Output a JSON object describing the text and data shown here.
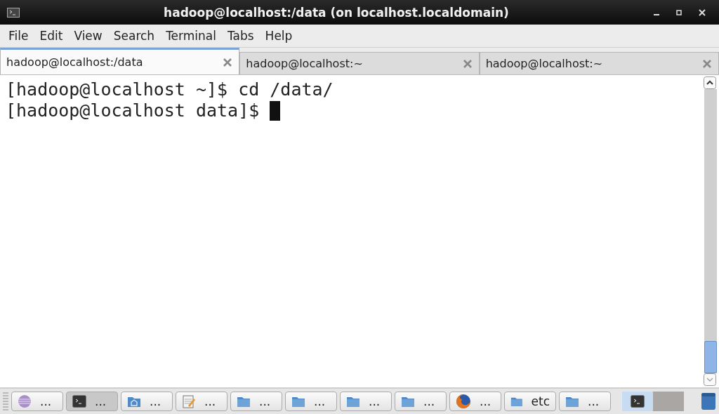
{
  "window": {
    "title": "hadoop@localhost:/data (on localhost.localdomain)"
  },
  "menu": [
    "File",
    "Edit",
    "View",
    "Search",
    "Terminal",
    "Tabs",
    "Help"
  ],
  "tabs": [
    {
      "label": "hadoop@localhost:/data",
      "selected": true
    },
    {
      "label": "hadoop@localhost:~",
      "selected": false
    },
    {
      "label": "hadoop@localhost:~",
      "selected": false
    }
  ],
  "terminal": {
    "lines": [
      "[hadoop@localhost ~]$ cd /data/",
      "[hadoop@localhost data]$ "
    ]
  },
  "taskbar": [
    {
      "kind": "globe",
      "label": "...",
      "selected": false
    },
    {
      "kind": "terminal",
      "label": "...",
      "selected": true
    },
    {
      "kind": "home",
      "label": "...",
      "selected": false
    },
    {
      "kind": "notepad",
      "label": "...",
      "selected": false
    },
    {
      "kind": "folder",
      "label": "...",
      "selected": false
    },
    {
      "kind": "folder",
      "label": "...",
      "selected": false
    },
    {
      "kind": "folder",
      "label": "...",
      "selected": false
    },
    {
      "kind": "folder",
      "label": "...",
      "selected": false
    },
    {
      "kind": "browser",
      "label": "...",
      "selected": false
    },
    {
      "kind": "folder",
      "label": "etc",
      "selected": false
    },
    {
      "kind": "folder",
      "label": "...",
      "selected": false
    }
  ],
  "workspaces": [
    {
      "selected": true
    },
    {
      "selected": false
    }
  ]
}
